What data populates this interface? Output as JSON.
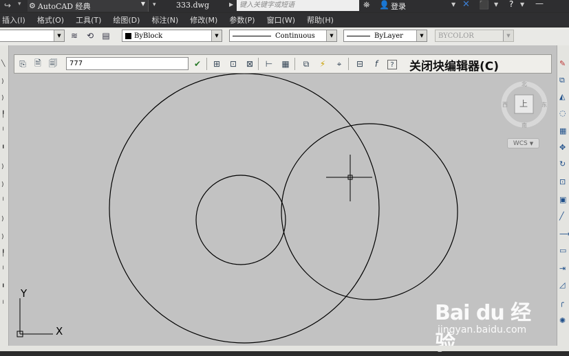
{
  "titlebar": {
    "workspace": "AutoCAD 经典",
    "filename": "333.dwg",
    "search_placeholder": "键入关键字或短语",
    "login": "登录"
  },
  "menubar": {
    "items": [
      "插入(I)",
      "格式(O)",
      "工具(T)",
      "绘图(D)",
      "标注(N)",
      "修改(M)",
      "参数(P)",
      "窗口(W)",
      "帮助(H)"
    ]
  },
  "properties": {
    "color": "ByBlock",
    "linetype": "Continuous",
    "lineweight": "ByLayer",
    "plotstyle": "BYCOLOR"
  },
  "block_editor": {
    "block_name": "777",
    "close_label": "关闭块编辑器(C)"
  },
  "viewcube": {
    "face_label": "上",
    "wcs_label": "WCS"
  },
  "ucs": {
    "x_label": "X",
    "y_label": "Y"
  },
  "watermark": {
    "brand": "Bai du 经验",
    "url": "jingyan.baidu.com"
  },
  "colors": {
    "canvas_bg": "#c2c2c2",
    "titlebar_bg": "#2e2e30",
    "toolbar_bg": "#e9e9e6"
  }
}
